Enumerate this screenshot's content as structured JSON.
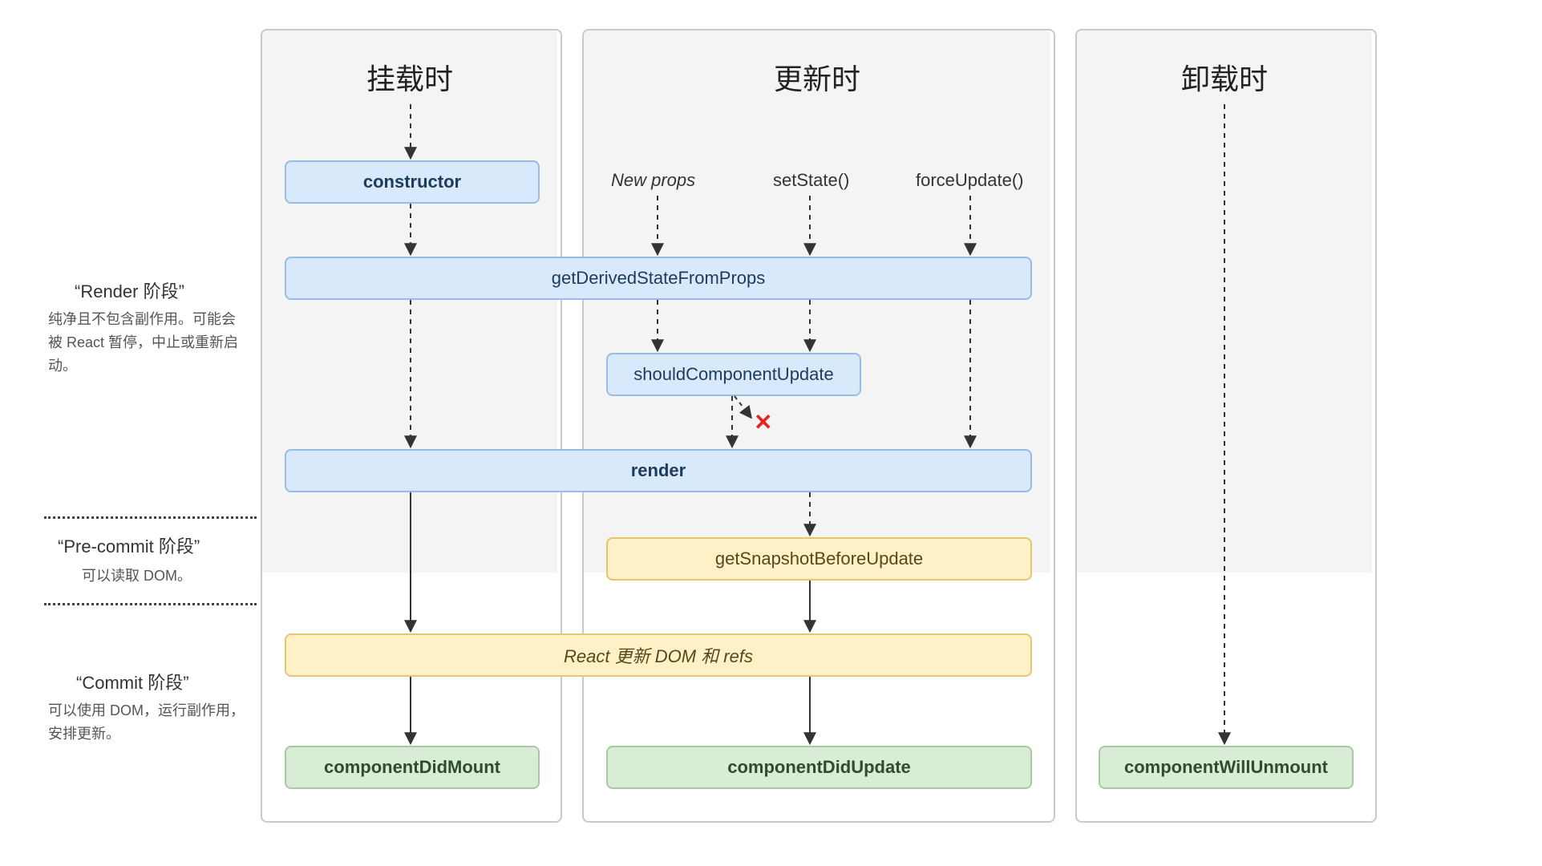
{
  "columns": {
    "mount": {
      "title": "挂载时"
    },
    "update": {
      "title": "更新时"
    },
    "unmount": {
      "title": "卸载时"
    }
  },
  "triggers": {
    "newProps": "New props",
    "setState": "setState()",
    "forceUpdate": "forceUpdate()"
  },
  "nodes": {
    "constructor": "constructor",
    "getDerivedStateFromProps": "getDerivedStateFromProps",
    "shouldComponentUpdate": "shouldComponentUpdate",
    "render": "render",
    "getSnapshotBeforeUpdate": "getSnapshotBeforeUpdate",
    "reactUpdatesDom": "React 更新 DOM 和 refs",
    "componentDidMount": "componentDidMount",
    "componentDidUpdate": "componentDidUpdate",
    "componentWillUnmount": "componentWillUnmount"
  },
  "side": {
    "render": {
      "heading": "“Render 阶段”",
      "sub": "纯净且不包含副作用。可能会被 React 暂停，中止或重新启动。"
    },
    "precommit": {
      "heading": "“Pre-commit 阶段”",
      "sub": "可以读取 DOM。"
    },
    "commit": {
      "heading": "“Commit 阶段”",
      "sub": "可以使用 DOM，运行副作用，安排更新。"
    }
  },
  "marks": {
    "bailX": "✕"
  }
}
